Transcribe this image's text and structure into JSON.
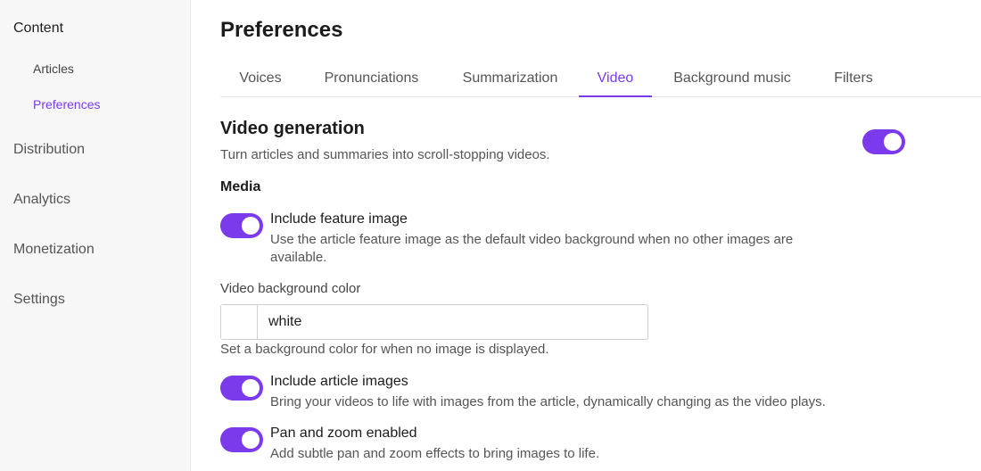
{
  "sidebar": {
    "content_label": "Content",
    "articles_label": "Articles",
    "preferences_label": "Preferences",
    "distribution_label": "Distribution",
    "analytics_label": "Analytics",
    "monetization_label": "Monetization",
    "settings_label": "Settings"
  },
  "page": {
    "title": "Preferences"
  },
  "tabs": [
    {
      "label": "Voices",
      "active": false
    },
    {
      "label": "Pronunciations",
      "active": false
    },
    {
      "label": "Summarization",
      "active": false
    },
    {
      "label": "Video",
      "active": true
    },
    {
      "label": "Background music",
      "active": false
    },
    {
      "label": "Filters",
      "active": false
    }
  ],
  "video_generation": {
    "title": "Video generation",
    "description": "Turn articles and summaries into scroll-stopping videos.",
    "enabled": true
  },
  "media": {
    "heading": "Media",
    "include_feature_image": {
      "label": "Include feature image",
      "description_line1": "Use the article feature image as the default video background when no other images are",
      "description_line2": "available.",
      "enabled": true
    },
    "background_color": {
      "label": "Video background color",
      "value": "white",
      "help": "Set a background color for when no image is displayed."
    },
    "include_article_images": {
      "label": "Include article images",
      "description": "Bring your videos to life with images from the article, dynamically changing as the video plays.",
      "enabled": true
    },
    "pan_zoom": {
      "label": "Pan and zoom enabled",
      "description": "Add subtle pan and zoom effects to bring images to life.",
      "enabled": true
    }
  },
  "colors": {
    "accent": "#7c3aed",
    "sidebar_bg": "#f7f7f7"
  }
}
